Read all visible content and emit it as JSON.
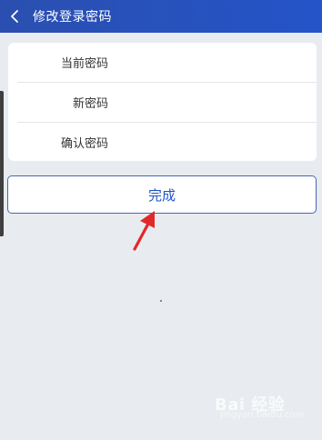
{
  "header": {
    "title": "修改登录密码"
  },
  "form": {
    "fields": [
      {
        "label": "当前密码",
        "value": "",
        "placeholder": ""
      },
      {
        "label": "新密码",
        "value": "",
        "placeholder": ""
      },
      {
        "label": "确认密码",
        "value": "",
        "placeholder": ""
      }
    ]
  },
  "actions": {
    "done_label": "完成"
  },
  "colors": {
    "header_bg": "#2454c8",
    "page_bg": "#e8ebef",
    "button_text": "#1f55c2",
    "arrow": "#e02a2a"
  },
  "watermark": {
    "text": "Bai 经验",
    "sub": "jingyan.baidu.com"
  }
}
